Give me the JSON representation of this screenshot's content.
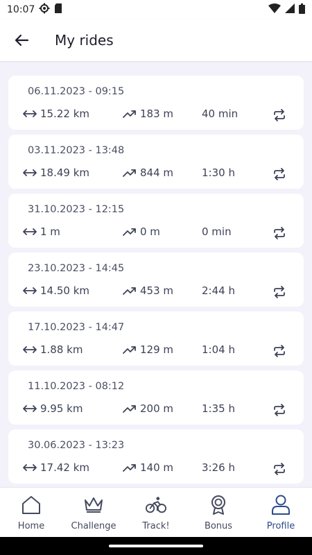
{
  "status_bar": {
    "time": "10:07"
  },
  "header": {
    "title": "My rides"
  },
  "rides": [
    {
      "date": "06.11.2023 - 09:15",
      "distance": "15.22 km",
      "elevation": "183 m",
      "duration": "40 min"
    },
    {
      "date": "03.11.2023 - 13:48",
      "distance": "18.49 km",
      "elevation": "844 m",
      "duration": "1:30 h"
    },
    {
      "date": "31.10.2023 - 12:15",
      "distance": "1 m",
      "elevation": "0 m",
      "duration": "0 min"
    },
    {
      "date": "23.10.2023 - 14:45",
      "distance": "14.50 km",
      "elevation": "453 m",
      "duration": "2:44 h"
    },
    {
      "date": "17.10.2023 - 14:47",
      "distance": "1.88 km",
      "elevation": "129 m",
      "duration": "1:04 h"
    },
    {
      "date": "11.10.2023 - 08:12",
      "distance": "9.95 km",
      "elevation": "200 m",
      "duration": "1:35 h"
    },
    {
      "date": "30.06.2023 - 13:23",
      "distance": "17.42 km",
      "elevation": "140 m",
      "duration": "3:26 h"
    }
  ],
  "bottom_nav": {
    "items": [
      {
        "label": "Home",
        "icon": "home-icon"
      },
      {
        "label": "Challenge",
        "icon": "crown-icon"
      },
      {
        "label": "Track!",
        "icon": "bicycle-icon"
      },
      {
        "label": "Bonus",
        "icon": "award-icon"
      },
      {
        "label": "Profile",
        "icon": "user-icon"
      }
    ],
    "active_label": "Profile"
  },
  "colors": {
    "background": "#f3f2fa",
    "card": "#ffffff",
    "text": "#3d4156",
    "active_nav": "#2c4a8a"
  }
}
